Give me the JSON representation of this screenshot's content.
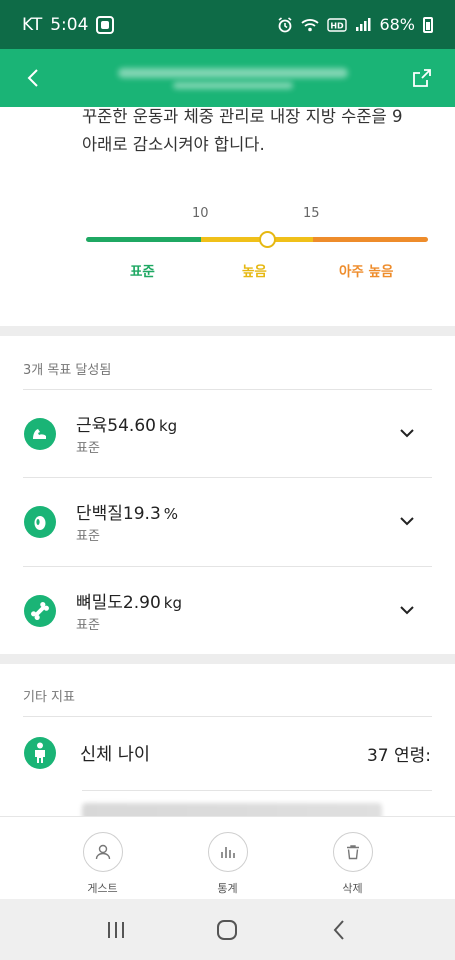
{
  "status_bar": {
    "carrier": "KT",
    "time": "5:04",
    "battery": "68%",
    "icons": [
      "app-icon",
      "alarm-icon",
      "wifi-icon",
      "hd-icon",
      "signal-icon",
      "battery-icon"
    ]
  },
  "header": {
    "back_icon": "back-icon",
    "share_icon": "share-icon"
  },
  "visceral_fat": {
    "description": "꾸준한 운동과 체중 관리로 내장 지방 수준을 9 아래로 감소시켜야 합니다.",
    "ticks": [
      "10",
      "15"
    ],
    "ranges": [
      "표준",
      "높음",
      "아주 높음"
    ],
    "range_colors": [
      "#1fa863",
      "#f0c019",
      "#ee8c2b"
    ]
  },
  "goals": {
    "heading": "3개 목표 달성됨",
    "items": [
      {
        "name": "근육",
        "value": "54.60",
        "unit": "kg",
        "status": "표준",
        "icon": "muscle-icon"
      },
      {
        "name": "단백질",
        "value": "19.3",
        "unit": "%",
        "status": "표준",
        "icon": "protein-icon"
      },
      {
        "name": "뼈밀도",
        "value": "2.90",
        "unit": "kg",
        "status": "표준",
        "icon": "bone-icon"
      }
    ]
  },
  "other": {
    "heading": "기타 지표",
    "items": [
      {
        "name": "신체 나이",
        "value": "37 연령:",
        "icon": "person-icon"
      }
    ]
  },
  "bottom_tabs": [
    {
      "label": "게스트",
      "icon": "person-icon"
    },
    {
      "label": "통계",
      "icon": "bar-chart-icon"
    },
    {
      "label": "삭제",
      "icon": "trash-icon"
    }
  ],
  "system_nav": [
    "recents-icon",
    "home-icon",
    "back-icon"
  ],
  "colors": {
    "status_bar": "#0e6b47",
    "header": "#1ab476",
    "accent": "#1ab476"
  }
}
